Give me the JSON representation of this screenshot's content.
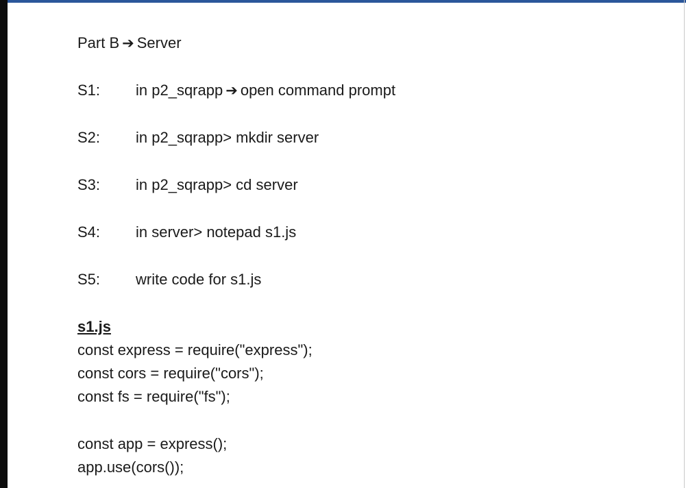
{
  "heading": {
    "prefix": "Part B",
    "arrow": "➔",
    "suffix": "Server"
  },
  "steps": [
    {
      "num": "S1:",
      "text_before": "in p2_sqrapp",
      "arrow": "➔",
      "text_after": "open command prompt"
    },
    {
      "num": "S2:",
      "text": "in p2_sqrapp> mkdir server"
    },
    {
      "num": "S3:",
      "text": "in p2_sqrapp> cd server"
    },
    {
      "num": "S4:",
      "text": "in server> notepad s1.js"
    },
    {
      "num": "S5:",
      "text": "write code for s1.js"
    }
  ],
  "file": {
    "title": "s1.js",
    "lines": [
      "const express = require(\"express\");",
      "const cors = require(\"cors\");",
      "const fs = require(\"fs\");",
      "",
      "const app = express();",
      "app.use(cors());"
    ]
  },
  "colors": {
    "top_bar": "#2b579a",
    "left_bar": "#0d0d0d",
    "text": "#1a1a1a"
  }
}
